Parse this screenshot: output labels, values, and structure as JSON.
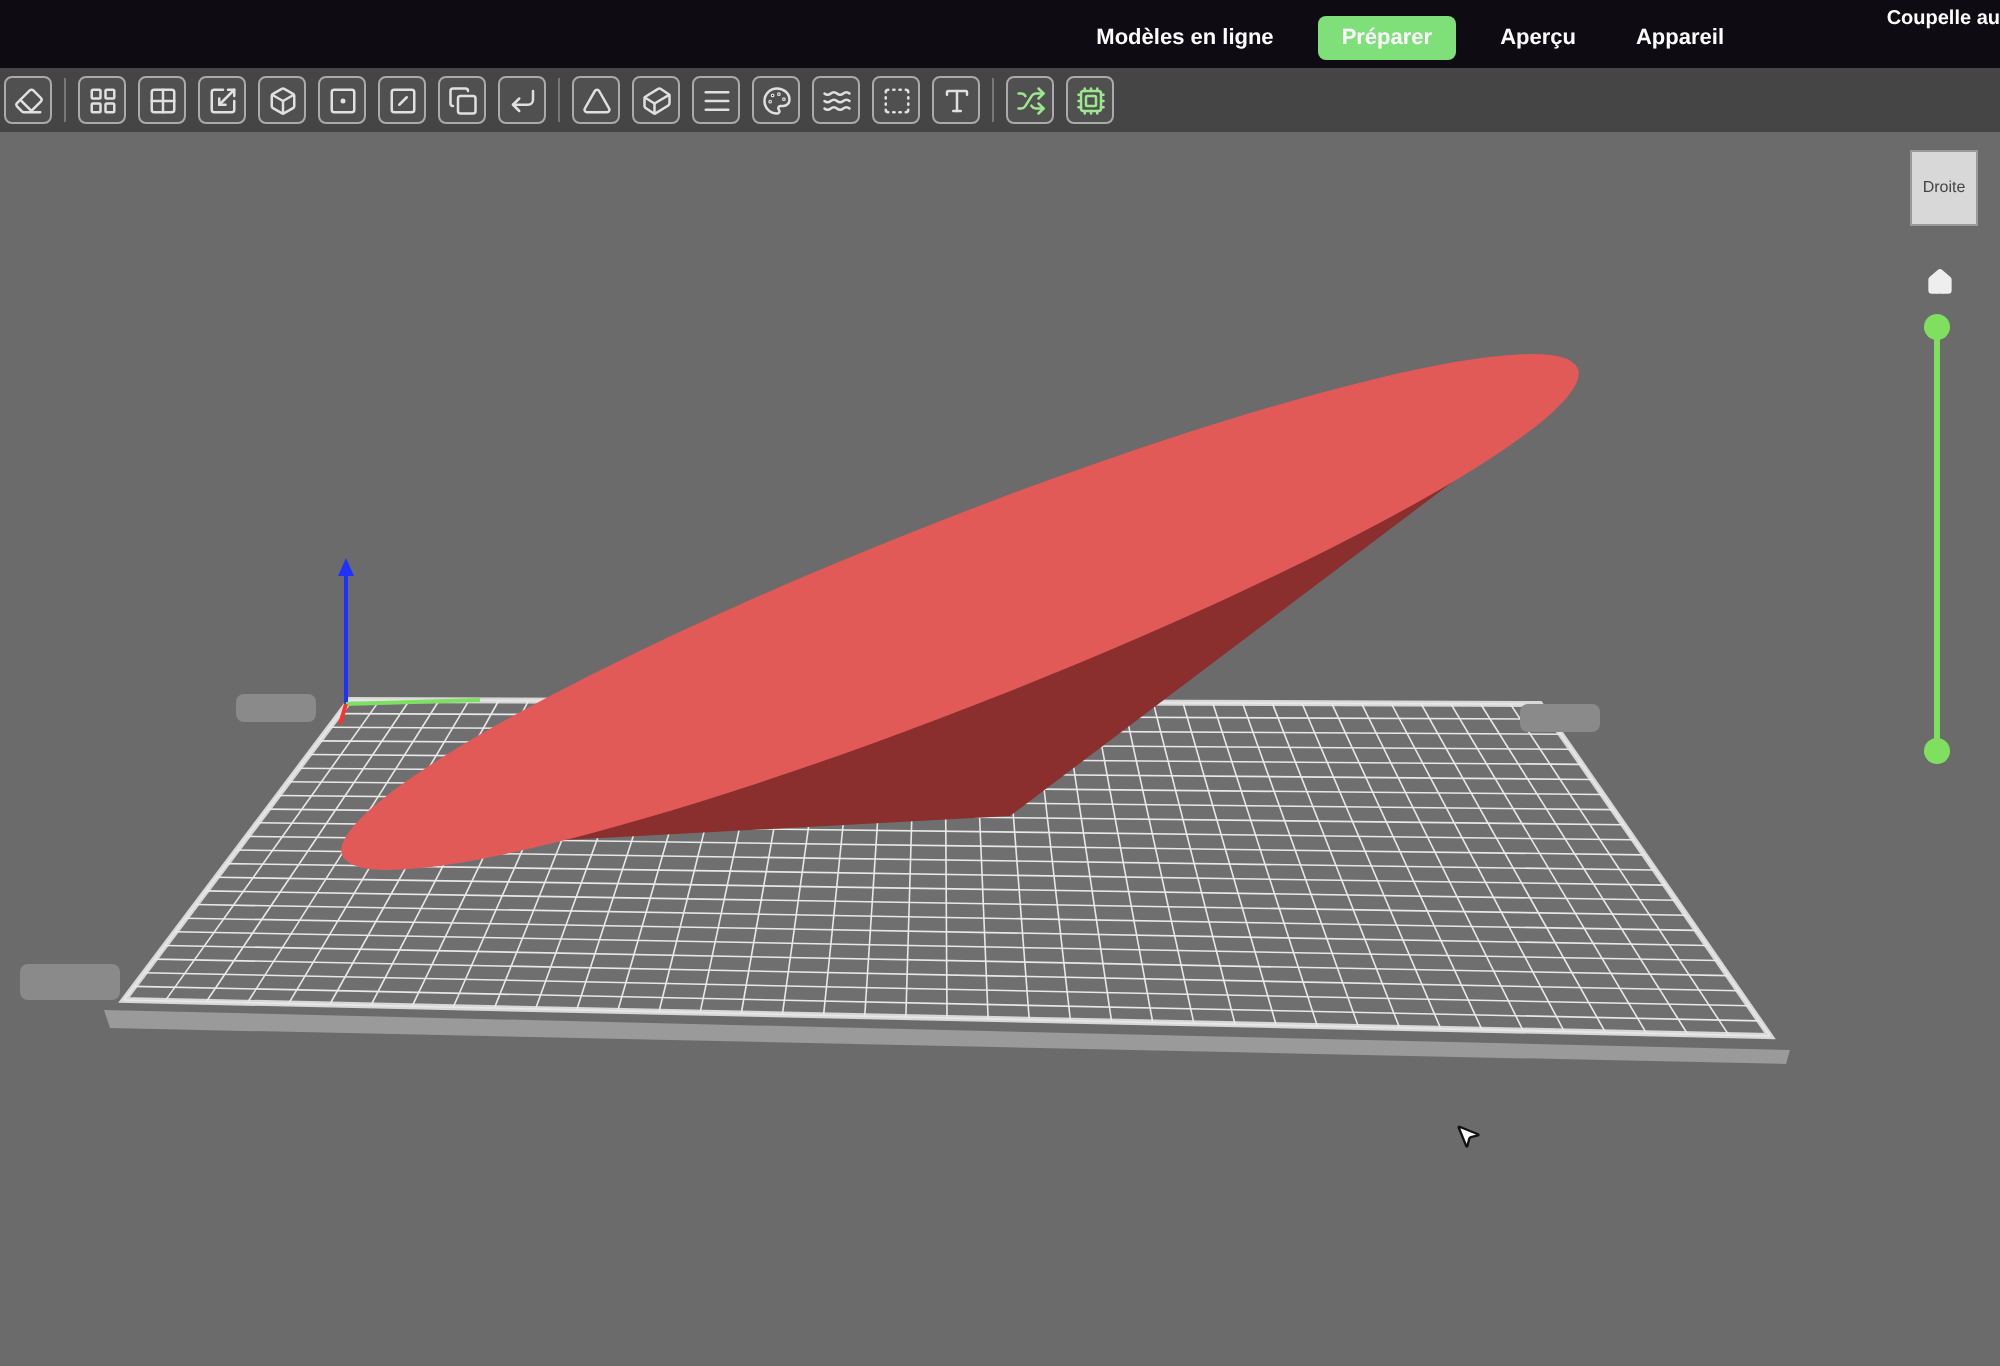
{
  "tabs": [
    {
      "label": "Modèles en ligne",
      "selected": false
    },
    {
      "label": "Préparer",
      "selected": true
    },
    {
      "label": "Aperçu",
      "selected": false
    },
    {
      "label": "Appareil",
      "selected": false
    }
  ],
  "project_title": "Coupelle au",
  "view_cube": {
    "label": "Droite"
  },
  "layer_slider": {
    "level": 1
  }
}
